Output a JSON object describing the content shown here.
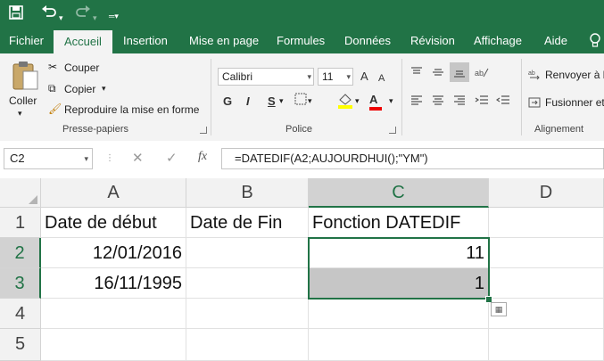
{
  "ribbon_tabs": [
    "Fichier",
    "Accueil",
    "Insertion",
    "Mise en page",
    "Formules",
    "Données",
    "Révision",
    "Affichage",
    "Aide"
  ],
  "active_tab": "Accueil",
  "clipboard": {
    "paste_label": "Coller",
    "cut_label": "Couper",
    "copy_label": "Copier",
    "format_painter_label": "Reproduire la mise en forme",
    "group_label": "Presse-papiers"
  },
  "font": {
    "name": "Calibri",
    "size": "11",
    "bold": "G",
    "italic": "I",
    "underline": "S",
    "grow": "A",
    "shrink": "A",
    "font_color_letter": "A",
    "group_label": "Police"
  },
  "alignment": {
    "wrap_label": "Renvoyer à l",
    "merge_label": "Fusionner et",
    "group_label": "Alignement"
  },
  "formula_bar": {
    "name_box": "C2",
    "fx": "fx",
    "formula": "=DATEDIF(A2;AUJOURDHUI();\"YM\")"
  },
  "columns": [
    "A",
    "B",
    "C",
    "D"
  ],
  "rows": [
    "1",
    "2",
    "3",
    "4",
    "5"
  ],
  "cells": {
    "A1": "Date de début",
    "B1": "Date de Fin",
    "C1": "Fonction DATEDIF",
    "A2": "12/01/2016",
    "C2": "11",
    "A3": "16/11/1995",
    "C3": "1"
  },
  "colors": {
    "accent": "#217346",
    "selection": "#d2d2d2"
  }
}
